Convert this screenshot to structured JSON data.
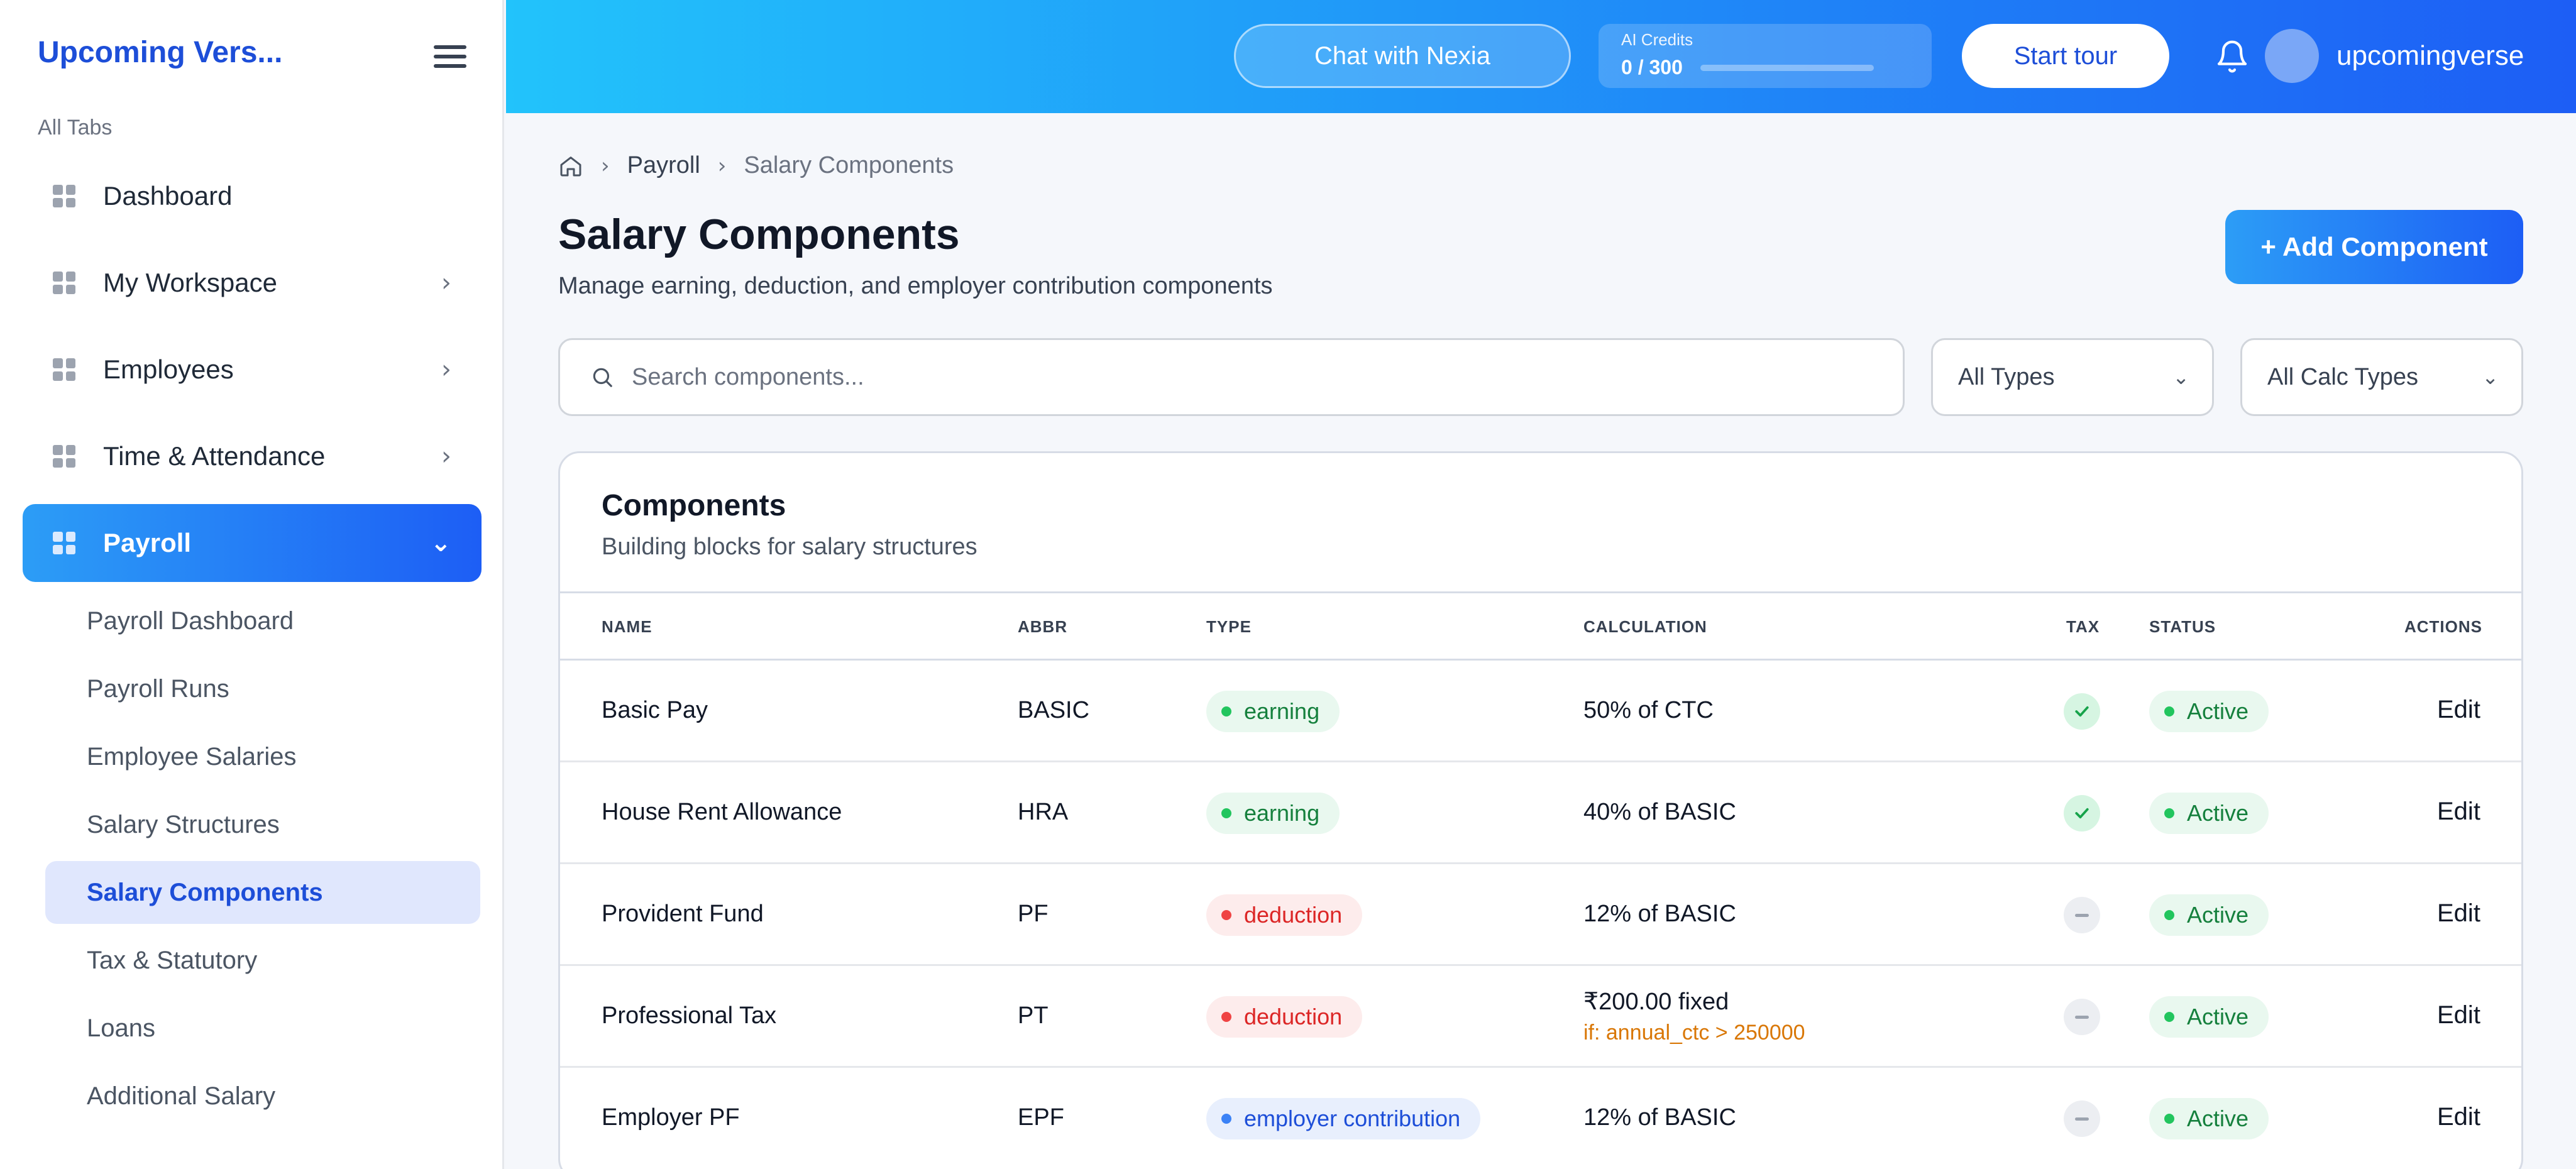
{
  "sidebar": {
    "brand": "Upcoming Vers...",
    "section_label": "All Tabs",
    "nav": [
      {
        "label": "Dashboard"
      },
      {
        "label": "My Workspace"
      },
      {
        "label": "Employees"
      },
      {
        "label": "Time & Attendance"
      },
      {
        "label": "Payroll"
      }
    ],
    "payroll_sub": [
      {
        "label": "Payroll Dashboard"
      },
      {
        "label": "Payroll Runs"
      },
      {
        "label": "Employee Salaries"
      },
      {
        "label": "Salary Structures"
      },
      {
        "label": "Salary Components"
      },
      {
        "label": "Tax & Statutory"
      },
      {
        "label": "Loans"
      },
      {
        "label": "Additional Salary"
      }
    ]
  },
  "header": {
    "chat_label": "Chat with Nexia",
    "credits_label": "AI Credits",
    "credits_value": "0 / 300",
    "credits_used": 0,
    "credits_total": 300,
    "tour_label": "Start tour",
    "username": "upcomingverse"
  },
  "breadcrumb": {
    "section": "Payroll",
    "current": "Salary Components"
  },
  "page": {
    "title": "Salary Components",
    "subtitle": "Manage earning, deduction, and employer contribution components",
    "add_button": "+ Add Component"
  },
  "filters": {
    "search_placeholder": "Search components...",
    "type_selected": "All Types",
    "calc_selected": "All Calc Types"
  },
  "card": {
    "title": "Components",
    "subtitle": "Building blocks for salary structures"
  },
  "table": {
    "headers": {
      "name": "NAME",
      "abbr": "ABBR",
      "type": "TYPE",
      "calculation": "CALCULATION",
      "tax": "TAX",
      "status": "STATUS",
      "actions": "ACTIONS"
    },
    "rows": [
      {
        "name": "Basic Pay",
        "abbr": "BASIC",
        "type": "earning",
        "calculation": "50% of CTC",
        "condition": "",
        "taxable": true,
        "status": "Active",
        "action": "Edit"
      },
      {
        "name": "House Rent Allowance",
        "abbr": "HRA",
        "type": "earning",
        "calculation": "40% of BASIC",
        "condition": "",
        "taxable": true,
        "status": "Active",
        "action": "Edit"
      },
      {
        "name": "Provident Fund",
        "abbr": "PF",
        "type": "deduction",
        "calculation": "12% of BASIC",
        "condition": "",
        "taxable": false,
        "status": "Active",
        "action": "Edit"
      },
      {
        "name": "Professional Tax",
        "abbr": "PT",
        "type": "deduction",
        "calculation": "₹200.00 fixed",
        "condition": "if: annual_ctc > 250000",
        "taxable": false,
        "status": "Active",
        "action": "Edit"
      },
      {
        "name": "Employer PF",
        "abbr": "EPF",
        "type": "employer contribution",
        "calculation": "12% of BASIC",
        "condition": "",
        "taxable": false,
        "status": "Active",
        "action": "Edit"
      }
    ]
  },
  "colors": {
    "accent": "#1d5ef5",
    "header_gradient_start": "#22c3fb",
    "earning": "#15803d",
    "deduction": "#dc2626",
    "employer_contribution": "#1d4ed8",
    "condition": "#d97706"
  }
}
